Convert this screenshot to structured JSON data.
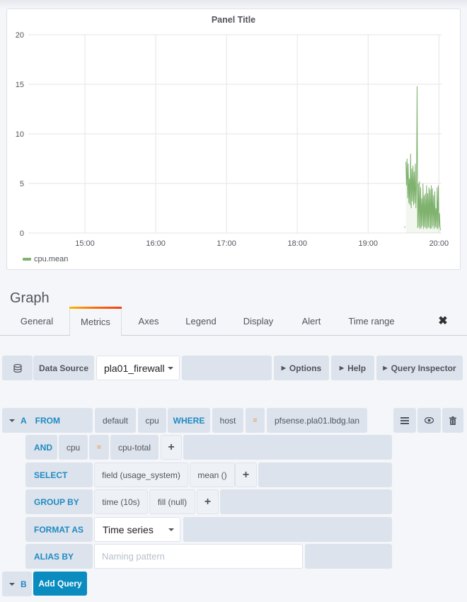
{
  "panel": {
    "title": "Panel Title",
    "legend": [
      {
        "label": "cpu.mean",
        "color": "#7eb26d"
      }
    ]
  },
  "chart_data": {
    "type": "line",
    "title": "Panel Title",
    "xlabel": "",
    "ylabel": "",
    "ylim": [
      0,
      20
    ],
    "y_ticks": [
      "0",
      "5",
      "10",
      "15",
      "20"
    ],
    "x_ticks": [
      "15:00",
      "16:00",
      "17:00",
      "18:00",
      "19:00",
      "20:00"
    ],
    "xlim_minutes": [
      852,
      1204
    ],
    "grid": true,
    "legend_position": "bottom-left",
    "series": [
      {
        "name": "cpu.mean",
        "color": "#7eb26d",
        "fill": true,
        "x_minutes": [
          1171,
          1172,
          1172.5,
          1173,
          1173.5,
          1174,
          1174.5,
          1175,
          1175.5,
          1176,
          1176.5,
          1177,
          1177.5,
          1178,
          1178.5,
          1179,
          1179.5,
          1180,
          1180.5,
          1181,
          1181.5,
          1182,
          1182.5,
          1183,
          1183.5,
          1184,
          1184.5,
          1185,
          1185.5,
          1186,
          1186.5,
          1187,
          1187.5,
          1188,
          1188.5,
          1189,
          1189.5,
          1190,
          1190.5,
          1191,
          1191.5,
          1192,
          1192.5,
          1193,
          1193.5,
          1194,
          1194.5,
          1195,
          1195.5,
          1196,
          1196.5,
          1197,
          1197.5,
          1198,
          1198.5,
          1199,
          1199.5,
          1200,
          1200.5,
          1201,
          1201.5
        ],
        "values": [
          0.6,
          7.2,
          4.8,
          7.5,
          3.5,
          7.0,
          3.0,
          5.5,
          2.8,
          8.0,
          2.5,
          6.5,
          3.2,
          6.8,
          2.8,
          6.2,
          3.0,
          7.0,
          2.5,
          5.0,
          14.8,
          0.5,
          5.0,
          0.6,
          5.2,
          0.4,
          4.6,
          0.5,
          3.5,
          0.7,
          5.0,
          0.4,
          3.8,
          0.6,
          4.0,
          0.5,
          4.8,
          0.4,
          4.0,
          0.6,
          4.6,
          0.5,
          4.4,
          0.4,
          4.8,
          0.5,
          4.5,
          0.7,
          3.8,
          0.4,
          4.2,
          0.6,
          2.5,
          0.5,
          4.6,
          0.4,
          4.8,
          0.6,
          2.0,
          0.5,
          0.3
        ]
      }
    ]
  },
  "editor": {
    "title": "Graph",
    "tabs": [
      {
        "label": "General",
        "active": false
      },
      {
        "label": "Metrics",
        "active": true
      },
      {
        "label": "Axes",
        "active": false
      },
      {
        "label": "Legend",
        "active": false
      },
      {
        "label": "Display",
        "active": false
      },
      {
        "label": "Alert",
        "active": false
      },
      {
        "label": "Time range",
        "active": false
      }
    ],
    "close_icon": "✖"
  },
  "datasource": {
    "icon": "database-icon",
    "label": "Data Source",
    "value": "pla01_firewall",
    "options_label": "Options",
    "help_label": "Help",
    "inspector_label": "Query Inspector"
  },
  "query_a": {
    "ref": "A",
    "from_kw": "FROM",
    "policy": "default",
    "measurement": "cpu",
    "where_kw": "WHERE",
    "tag1_key": "host",
    "tag1_op": "=",
    "tag1_value": "pfsense.pla01.lbdg.lan",
    "and_kw": "AND",
    "tag2_key": "cpu",
    "tag2_op": "=",
    "tag2_value": "cpu-total",
    "select_kw": "SELECT",
    "select_field": "field (usage_system)",
    "select_fn": "mean ()",
    "groupby_kw": "GROUP BY",
    "group_time": "time (10s)",
    "group_fill": "fill (null)",
    "format_kw": "FORMAT AS",
    "format_value": "Time series",
    "alias_kw": "ALIAS BY",
    "alias_placeholder": "Naming pattern",
    "plus": "+"
  },
  "query_b": {
    "ref": "B",
    "add_label": "Add Query"
  }
}
